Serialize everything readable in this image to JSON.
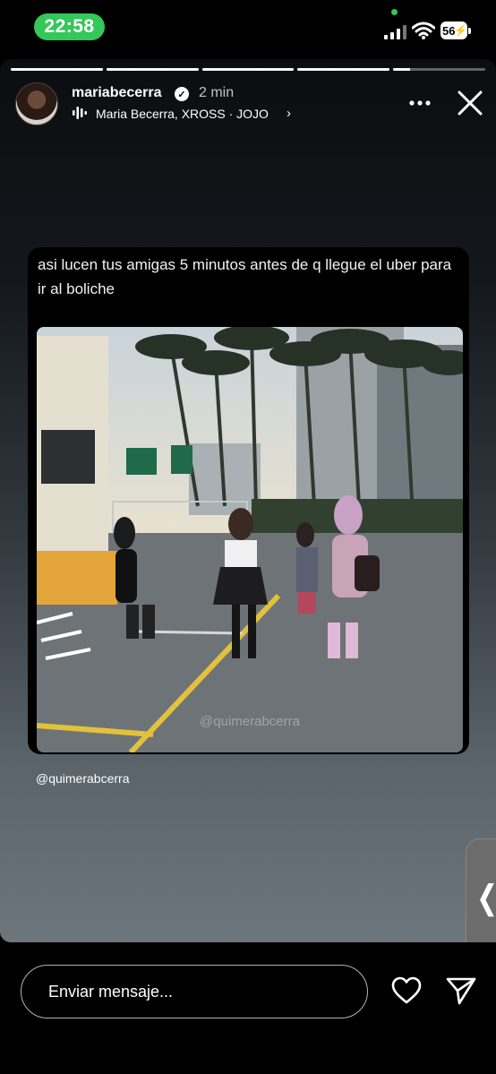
{
  "status": {
    "time": "22:58",
    "battery": "56"
  },
  "story": {
    "progress": [
      1,
      1,
      1,
      1,
      0.18
    ],
    "username": "mariabecerra",
    "time_ago": "2 min",
    "music": "Maria Becerra, XROSS · JOJO",
    "caption": "asi lucen tus amigas 5 minutos antes de q llegue el uber para ir al boliche",
    "photo_watermark": "@quimerabcerra",
    "handle": "@quimerabcerra",
    "side_tab_glyph": "❬"
  },
  "icons": {
    "verified": "verified-badge-icon",
    "music": "audio-bars-icon",
    "more": "ellipsis-icon",
    "close": "close-icon",
    "heart": "heart-icon",
    "send": "send-icon"
  },
  "message": {
    "placeholder": "Enviar mensaje..."
  },
  "colors": {
    "status_green": "#34c759",
    "background": "#000000"
  }
}
